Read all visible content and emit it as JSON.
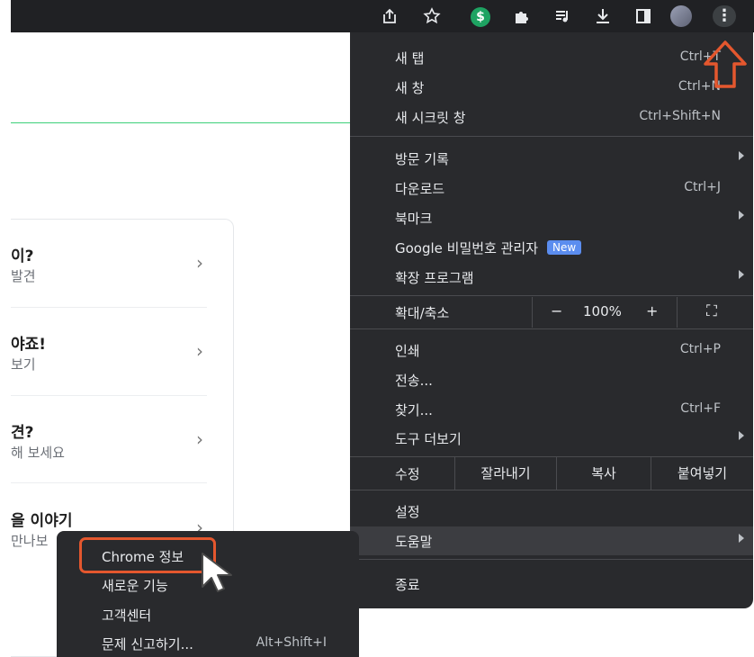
{
  "toolbar": {
    "icons": [
      "share-icon",
      "star-icon",
      "extension-dollar-icon",
      "puzzle-icon",
      "media-queue-icon",
      "download-icon",
      "sidebar-icon",
      "avatar",
      "more-icon"
    ],
    "extension_dollar_symbol": "$",
    "more_symbol": "⋮",
    "accent_green": "#1ea362"
  },
  "page": {
    "cards": [
      {
        "title": "이?",
        "subtitle": "발견"
      },
      {
        "title": "야죠!",
        "subtitle": "보기"
      },
      {
        "title": "견?",
        "subtitle": "해 보세요"
      },
      {
        "title": "을 이야기",
        "subtitle": "만나보"
      }
    ],
    "chevron": "›"
  },
  "menu": {
    "new_tab": {
      "label": "새 탭",
      "shortcut": "Ctrl+T"
    },
    "new_window": {
      "label": "새 창",
      "shortcut": "Ctrl+N"
    },
    "incognito": {
      "label": "새 시크릿 창",
      "shortcut": "Ctrl+Shift+N"
    },
    "history": {
      "label": "방문 기록"
    },
    "downloads": {
      "label": "다운로드",
      "shortcut": "Ctrl+J"
    },
    "bookmarks": {
      "label": "북마크"
    },
    "password_manager": {
      "label": "Google 비밀번호 관리자",
      "badge": "New"
    },
    "extensions": {
      "label": "확장 프로그램"
    },
    "zoom": {
      "label": "확대/축소",
      "minus": "−",
      "value": "100%",
      "plus": "+",
      "fullscreen": "⛶"
    },
    "print": {
      "label": "인쇄",
      "shortcut": "Ctrl+P"
    },
    "cast": {
      "label": "전송..."
    },
    "find": {
      "label": "찾기...",
      "shortcut": "Ctrl+F"
    },
    "more_tools": {
      "label": "도구 더보기"
    },
    "edit": {
      "label": "수정",
      "cut": "잘라내기",
      "copy": "복사",
      "paste": "붙여넣기"
    },
    "settings": {
      "label": "설정"
    },
    "help": {
      "label": "도움말"
    },
    "exit": {
      "label": "종료"
    }
  },
  "help_submenu": {
    "about": {
      "label": "Chrome 정보"
    },
    "whats_new": {
      "label": "새로운 기능"
    },
    "help_center": {
      "label": "고객센터"
    },
    "report_issue": {
      "label": "문제 신고하기...",
      "shortcut": "Alt+Shift+I"
    }
  },
  "colors": {
    "menu_bg": "#292a2d",
    "highlight": "#3c3d41",
    "annotation_orange": "#e4572e",
    "badge_blue": "#5b8def"
  }
}
